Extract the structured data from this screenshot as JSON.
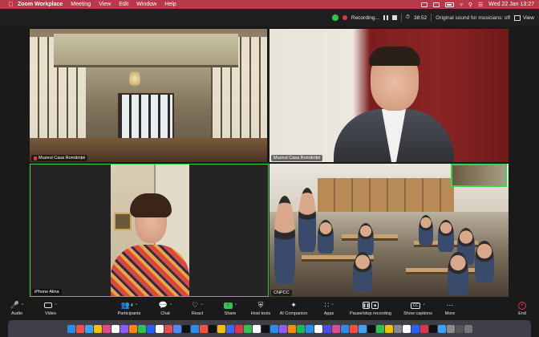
{
  "menubar": {
    "app_name": "Zoom Workplace",
    "items": [
      "Meeting",
      "View",
      "Edit",
      "Window",
      "Help"
    ],
    "datetime": "Wed 22 Jan  13:27"
  },
  "zoom_bar": {
    "recording_label": "Recording...",
    "timer": "38:52",
    "original_sound": "Original sound for musicians: off",
    "view_label": "View"
  },
  "tiles": [
    {
      "name": "Muzeul Casa Româniței",
      "muted": true
    },
    {
      "name": "Muzeul Casa Româniței",
      "muted": false
    },
    {
      "name": "iPhone Alina",
      "muted": false
    },
    {
      "name": "CNPCC",
      "muted": false
    }
  ],
  "toolbar": {
    "audio": "Audio",
    "video": "Video",
    "participants": "Participants",
    "participants_count": "4",
    "chat": "Chat",
    "react": "React",
    "share": "Share",
    "host_tools": "Host tools",
    "ai_companion": "AI Companion",
    "apps": "Apps",
    "pause_stop": "Pause/stop recording",
    "captions": "Show captions",
    "more": "More",
    "end": "End"
  },
  "colors": {
    "menubar_bg": "#b83a4a",
    "active_speaker_border": "#3ad24f",
    "share_green": "#2fc24e",
    "end_red": "#e0344a"
  },
  "dock_apps": [
    "#2a8ef0",
    "#ff4f3a",
    "#3aa4ff",
    "#f2c200",
    "#e04a8a",
    "#ffffff",
    "#8f5cff",
    "#ff8a00",
    "#2fc24e",
    "#2a60ff",
    "#ffffff",
    "#f04a4a",
    "#4a8aff",
    "#111111",
    "#2a8ef0",
    "#ff4f3a",
    "#111111",
    "#f2c200",
    "#3a6aff",
    "#e0344a",
    "#2fc24e",
    "#ffffff",
    "#111111",
    "#2a8ef0",
    "#8f5cff",
    "#ff8a00",
    "#1db954",
    "#2a8ef0",
    "#ffffff",
    "#4a4aff",
    "#e04a8a",
    "#2a8ef0",
    "#ff4f3a",
    "#3aa4ff",
    "#111111",
    "#2fc24e",
    "#f2c200",
    "#8a8a8a",
    "#ffffff",
    "#2a60ff",
    "#e0344a",
    "#111111",
    "#3aa4ff",
    "#8a8a8a",
    "#555555",
    "#777777"
  ]
}
